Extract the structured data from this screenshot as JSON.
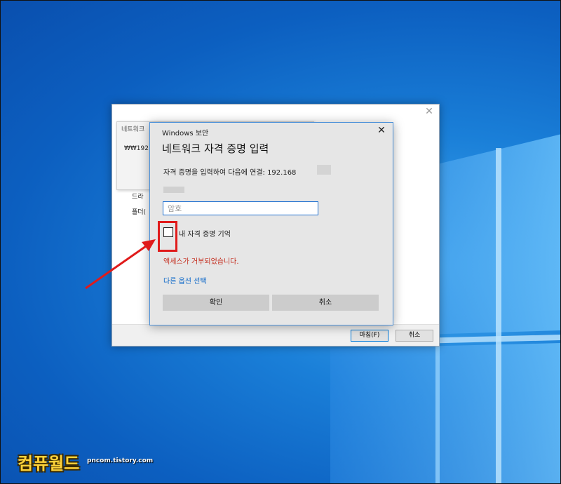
{
  "outer_dialog": {
    "behind_title": "네트워크",
    "behind_path": "₩₩192.1",
    "label_1": "드라",
    "label_2": "폴더(",
    "close_glyph": "✕",
    "finish_label": "마침(F)",
    "cancel_label": "취소"
  },
  "security_dialog": {
    "window_title": "Windows 보안",
    "close_glyph": "✕",
    "heading": "네트워크 자격 증명 입력",
    "description": "자격 증명을 입력하여 다음에 연결: 192.168",
    "password_placeholder": "암호",
    "remember_label": "내 자격 증명 기억",
    "error_message": "액세스가 거부되었습니다.",
    "more_options": "다른 옵션 선택",
    "ok_label": "확인",
    "cancel_label": "취소"
  },
  "watermark": {
    "logo_text": "컴퓨월드",
    "site": "pncom.tistory.com"
  },
  "colors": {
    "accent_blue": "#0078d7",
    "error_red": "#c42b1c",
    "highlight_red": "#e01b1b"
  }
}
